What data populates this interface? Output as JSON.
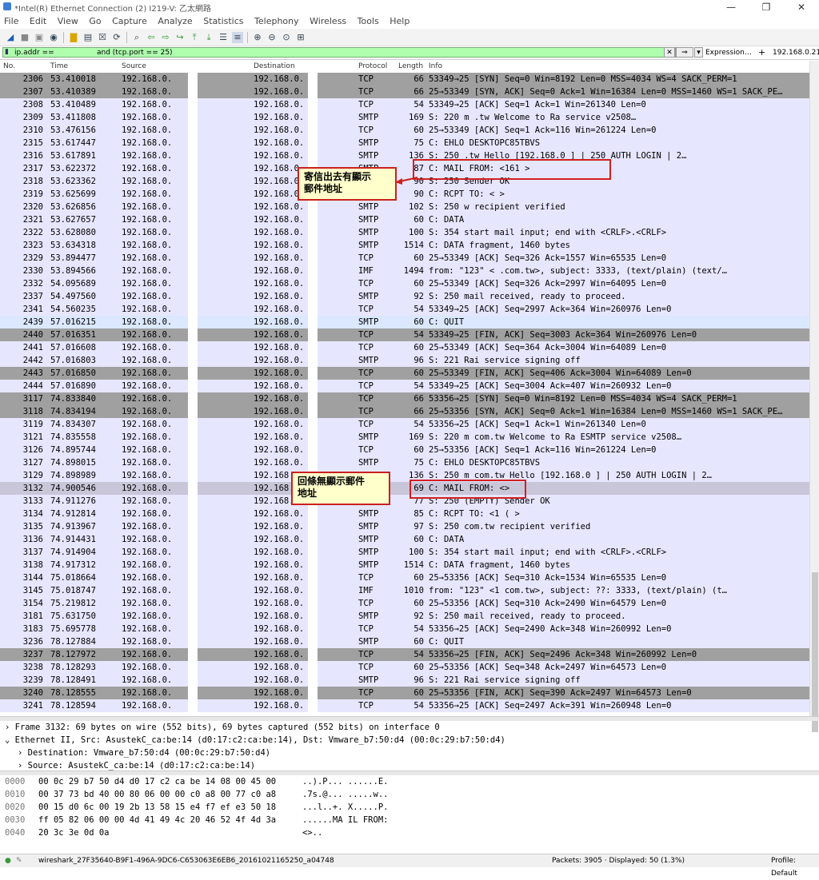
{
  "window": {
    "title": "*Intel(R) Ethernet Connection (2) I219-V: 乙太網路",
    "buttons": [
      "—",
      "❐",
      "✕"
    ]
  },
  "menu": [
    "File",
    "Edit",
    "View",
    "Go",
    "Capture",
    "Analyze",
    "Statistics",
    "Telephony",
    "Wireless",
    "Tools",
    "Help"
  ],
  "toolbar_icons": [
    "shark-fin-icon",
    "stop-icon",
    "restart-icon",
    "options-icon",
    "open-icon",
    "save-icon",
    "close-file-icon",
    "reload-icon",
    "find-icon",
    "back-icon",
    "forward-icon",
    "goto-icon",
    "first-icon",
    "last-icon",
    "autoscroll-icon",
    "colorize-icon",
    "zoom-in-icon",
    "zoom-out-icon",
    "zoom-reset-icon",
    "resize-columns-icon"
  ],
  "filter": {
    "text_part1": "ip.addr ==",
    "text_part2": "and (tcp.port == 25)",
    "expression_label": "Expression…",
    "plus_label": "+",
    "ip_button": "192.168.0.21",
    "bg_color": "#afffaf"
  },
  "columns": [
    "No.",
    "Time",
    "Source",
    "Destination",
    "Protocol",
    "Length",
    "Info"
  ],
  "packets": [
    {
      "no": "2306",
      "time": "53.410018",
      "src": "192.168.0.",
      "dst": "192.168.0.",
      "proto": "TCP",
      "len": "66",
      "info": "53349→25 [SYN] Seq=0 Win=8192 Len=0 MSS=4034 WS=4 SACK_PERM=1",
      "cls": "c-syn"
    },
    {
      "no": "2307",
      "time": "53.410389",
      "src": "192.168.0.",
      "dst": "192.168.0.",
      "proto": "TCP",
      "len": "66",
      "info": "25→53349 [SYN, ACK] Seq=0 Ack=1 Win=16384 Len=0 MSS=1460 WS=1 SACK_PE…",
      "cls": "c-syn"
    },
    {
      "no": "2308",
      "time": "53.410489",
      "src": "192.168.0.",
      "dst": "192.168.0.",
      "proto": "TCP",
      "len": "54",
      "info": "53349→25 [ACK] Seq=1 Ack=1 Win=261340 Len=0",
      "cls": "c-tcp"
    },
    {
      "no": "2309",
      "time": "53.411808",
      "src": "192.168.0.",
      "dst": "192.168.0.",
      "proto": "SMTP",
      "len": "169",
      "info": "S: 220          m      .tw Welcome to Ra                  service v2508…",
      "cls": "c-smtp"
    },
    {
      "no": "2310",
      "time": "53.476156",
      "src": "192.168.0.",
      "dst": "192.168.0.",
      "proto": "TCP",
      "len": "60",
      "info": "25→53349 [ACK] Seq=1 Ack=116 Win=261224 Len=0",
      "cls": "c-tcp"
    },
    {
      "no": "2315",
      "time": "53.617447",
      "src": "192.168.0.",
      "dst": "192.168.0.",
      "proto": "SMTP",
      "len": "75",
      "info": "C: EHLO DESKTOPC85TBVS",
      "cls": "c-smtp"
    },
    {
      "no": "2316",
      "time": "53.617891",
      "src": "192.168.0.",
      "dst": "192.168.0.",
      "proto": "SMTP",
      "len": "136",
      "info": "S: 250              .tw Hello [192.168.0     ] | 250 AUTH LOGIN | 2…",
      "cls": "c-smtp"
    },
    {
      "no": "2317",
      "time": "53.622372",
      "src": "192.168.0.",
      "dst": "192.168.0.",
      "proto": "SMTP",
      "len": "87",
      "info": "C: MAIL FROM: <161               >",
      "cls": "c-smtp"
    },
    {
      "no": "2318",
      "time": "53.623362",
      "src": "192.168.0.",
      "dst": "192.168.0.",
      "proto": "SMTP",
      "len": "90",
      "info": "S: 250                    Sender OK",
      "cls": "c-smtp"
    },
    {
      "no": "2319",
      "time": "53.625699",
      "src": "192.168.0.",
      "dst": "192.168.0.",
      "proto": "SMTP",
      "len": "90",
      "info": "C: RCPT TO: <                      >",
      "cls": "c-smtp"
    },
    {
      "no": "2320",
      "time": "53.626856",
      "src": "192.168.0.",
      "dst": "192.168.0.",
      "proto": "SMTP",
      "len": "102",
      "info": "S: 250                    w recipient verified",
      "cls": "c-smtp"
    },
    {
      "no": "2321",
      "time": "53.627657",
      "src": "192.168.0.",
      "dst": "192.168.0.",
      "proto": "SMTP",
      "len": "60",
      "info": "C: DATA",
      "cls": "c-smtp"
    },
    {
      "no": "2322",
      "time": "53.628080",
      "src": "192.168.0.",
      "dst": "192.168.0.",
      "proto": "SMTP",
      "len": "100",
      "info": "S: 354 start mail input; end with <CRLF>.<CRLF>",
      "cls": "c-smtp"
    },
    {
      "no": "2323",
      "time": "53.634318",
      "src": "192.168.0.",
      "dst": "192.168.0.",
      "proto": "SMTP",
      "len": "1514",
      "info": "C: DATA fragment, 1460 bytes",
      "cls": "c-smtp"
    },
    {
      "no": "2329",
      "time": "53.894477",
      "src": "192.168.0.",
      "dst": "192.168.0.",
      "proto": "TCP",
      "len": "60",
      "info": "25→53349 [ACK] Seq=326 Ack=1557 Win=65535 Len=0",
      "cls": "c-tcp"
    },
    {
      "no": "2330",
      "time": "53.894566",
      "src": "192.168.0.",
      "dst": "192.168.0.",
      "proto": "IMF",
      "len": "1494",
      "info": "from: \"123\" <           .com.tw>, subject: 3333,  (text/plain) (text/…",
      "cls": "c-imf"
    },
    {
      "no": "2332",
      "time": "54.095689",
      "src": "192.168.0.",
      "dst": "192.168.0.",
      "proto": "TCP",
      "len": "60",
      "info": "25→53349 [ACK] Seq=326 Ack=2997 Win=64095 Len=0",
      "cls": "c-tcp"
    },
    {
      "no": "2337",
      "time": "54.497560",
      "src": "192.168.0.",
      "dst": "192.168.0.",
      "proto": "SMTP",
      "len": "92",
      "info": "S: 250 mail received, ready to proceed.",
      "cls": "c-smtp"
    },
    {
      "no": "2341",
      "time": "54.560235",
      "src": "192.168.0.",
      "dst": "192.168.0.",
      "proto": "TCP",
      "len": "54",
      "info": "53349→25 [ACK] Seq=2997 Ack=364 Win=260976 Len=0",
      "cls": "c-tcp"
    },
    {
      "no": "2439",
      "time": "57.016215",
      "src": "192.168.0.",
      "dst": "192.168.0.",
      "proto": "SMTP",
      "len": "60",
      "info": "C: QUIT",
      "cls": "c-quit"
    },
    {
      "no": "2440",
      "time": "57.016351",
      "src": "192.168.0.",
      "dst": "192.168.0.",
      "proto": "TCP",
      "len": "54",
      "info": "53349→25 [FIN, ACK] Seq=3003 Ack=364 Win=260976 Len=0",
      "cls": "c-fin"
    },
    {
      "no": "2441",
      "time": "57.016608",
      "src": "192.168.0.",
      "dst": "192.168.0.",
      "proto": "TCP",
      "len": "60",
      "info": "25→53349 [ACK] Seq=364 Ack=3004 Win=64089 Len=0",
      "cls": "c-tcp"
    },
    {
      "no": "2442",
      "time": "57.016803",
      "src": "192.168.0.",
      "dst": "192.168.0.",
      "proto": "SMTP",
      "len": "96",
      "info": "S: 221 Rai                 service signing off",
      "cls": "c-smtp"
    },
    {
      "no": "2443",
      "time": "57.016850",
      "src": "192.168.0.",
      "dst": "192.168.0.",
      "proto": "TCP",
      "len": "60",
      "info": "25→53349 [FIN, ACK] Seq=406 Ack=3004 Win=64089 Len=0",
      "cls": "c-fin"
    },
    {
      "no": "2444",
      "time": "57.016890",
      "src": "192.168.0.",
      "dst": "192.168.0.",
      "proto": "TCP",
      "len": "54",
      "info": "53349→25 [ACK] Seq=3004 Ack=407 Win=260932 Len=0",
      "cls": "c-tcp"
    },
    {
      "no": "3117",
      "time": "74.833840",
      "src": "192.168.0.",
      "dst": "192.168.0.",
      "proto": "TCP",
      "len": "66",
      "info": "53356→25 [SYN] Seq=0 Win=8192 Len=0 MSS=4034 WS=4 SACK_PERM=1",
      "cls": "c-syn"
    },
    {
      "no": "3118",
      "time": "74.834194",
      "src": "192.168.0.",
      "dst": "192.168.0.",
      "proto": "TCP",
      "len": "66",
      "info": "25→53356 [SYN, ACK] Seq=0 Ack=1 Win=16384 Len=0 MSS=1460 WS=1 SACK_PE…",
      "cls": "c-syn"
    },
    {
      "no": "3119",
      "time": "74.834307",
      "src": "192.168.0.",
      "dst": "192.168.0.",
      "proto": "TCP",
      "len": "54",
      "info": "53356→25 [ACK] Seq=1 Ack=1 Win=261340 Len=0",
      "cls": "c-tcp"
    },
    {
      "no": "3121",
      "time": "74.835558",
      "src": "192.168.0.",
      "dst": "192.168.0.",
      "proto": "SMTP",
      "len": "169",
      "info": "S: 220 m           com.tw Welcome to Ra              ESMTP service v2508…",
      "cls": "c-smtp"
    },
    {
      "no": "3126",
      "time": "74.895744",
      "src": "192.168.0.",
      "dst": "192.168.0.",
      "proto": "TCP",
      "len": "60",
      "info": "25→53356 [ACK] Seq=1 Ack=116 Win=261224 Len=0",
      "cls": "c-tcp"
    },
    {
      "no": "3127",
      "time": "74.898015",
      "src": "192.168.0.",
      "dst": "192.168.0.",
      "proto": "SMTP",
      "len": "75",
      "info": "C: EHLO DESKTOPC85TBVS",
      "cls": "c-smtp"
    },
    {
      "no": "3129",
      "time": "74.898989",
      "src": "192.168.0.",
      "dst": "192.168",
      "proto": "SMTP",
      "len": "136",
      "info": "S: 250 m           com.tw Hello [192.168.0     ] | 250 AUTH LOGIN | 2…",
      "cls": "c-smtp"
    },
    {
      "no": "3132",
      "time": "74.900546",
      "src": "192.168.0.",
      "dst": "192.168",
      "proto": "SMTP",
      "len": "69",
      "info": "C: MAIL FROM: <>",
      "cls": "c-sel"
    },
    {
      "no": "3133",
      "time": "74.911276",
      "src": "192.168.0.",
      "dst": "192.168.0.",
      "proto": "SMTP",
      "len": "77",
      "info": "S: 250 (EMPTY) Sender OK",
      "cls": "c-smtp"
    },
    {
      "no": "3134",
      "time": "74.912814",
      "src": "192.168.0.",
      "dst": "192.168.0.",
      "proto": "SMTP",
      "len": "85",
      "info": "C: RCPT TO: <1   (                >",
      "cls": "c-smtp"
    },
    {
      "no": "3135",
      "time": "74.913967",
      "src": "192.168.0.",
      "dst": "192.168.0.",
      "proto": "SMTP",
      "len": "97",
      "info": "S: 250           com.tw recipient verified",
      "cls": "c-smtp"
    },
    {
      "no": "3136",
      "time": "74.914431",
      "src": "192.168.0.",
      "dst": "192.168.0.",
      "proto": "SMTP",
      "len": "60",
      "info": "C: DATA",
      "cls": "c-smtp"
    },
    {
      "no": "3137",
      "time": "74.914904",
      "src": "192.168.0.",
      "dst": "192.168.0.",
      "proto": "SMTP",
      "len": "100",
      "info": "S: 354 start mail input; end with <CRLF>.<CRLF>",
      "cls": "c-smtp"
    },
    {
      "no": "3138",
      "time": "74.917312",
      "src": "192.168.0.",
      "dst": "192.168.0.",
      "proto": "SMTP",
      "len": "1514",
      "info": "C: DATA fragment, 1460 bytes",
      "cls": "c-smtp"
    },
    {
      "no": "3144",
      "time": "75.018664",
      "src": "192.168.0.",
      "dst": "192.168.0.",
      "proto": "TCP",
      "len": "60",
      "info": "25→53356 [ACK] Seq=310 Ack=1534 Win=65535 Len=0",
      "cls": "c-tcp"
    },
    {
      "no": "3145",
      "time": "75.018747",
      "src": "192.168.0.",
      "dst": "192.168.0.",
      "proto": "IMF",
      "len": "1010",
      "info": "from: \"123\" <1          com.tw>, subject: ??: 3333,  (text/plain) (t…",
      "cls": "c-imf"
    },
    {
      "no": "3154",
      "time": "75.219812",
      "src": "192.168.0.",
      "dst": "192.168.0.",
      "proto": "TCP",
      "len": "60",
      "info": "25→53356 [ACK] Seq=310 Ack=2490 Win=64579 Len=0",
      "cls": "c-tcp"
    },
    {
      "no": "3181",
      "time": "75.631750",
      "src": "192.168.0.",
      "dst": "192.168.0.",
      "proto": "SMTP",
      "len": "92",
      "info": "S: 250 mail received, ready to proceed.",
      "cls": "c-smtp"
    },
    {
      "no": "3183",
      "time": "75.695778",
      "src": "192.168.0.",
      "dst": "192.168.0.",
      "proto": "TCP",
      "len": "54",
      "info": "53356→25 [ACK] Seq=2490 Ack=348 Win=260992 Len=0",
      "cls": "c-tcp"
    },
    {
      "no": "3236",
      "time": "78.127884",
      "src": "192.168.0.",
      "dst": "192.168.0.",
      "proto": "SMTP",
      "len": "60",
      "info": "C: QUIT",
      "cls": "c-smtp"
    },
    {
      "no": "3237",
      "time": "78.127972",
      "src": "192.168.0.",
      "dst": "192.168.0.",
      "proto": "TCP",
      "len": "54",
      "info": "53356→25 [FIN, ACK] Seq=2496 Ack=348 Win=260992 Len=0",
      "cls": "c-fin"
    },
    {
      "no": "3238",
      "time": "78.128293",
      "src": "192.168.0.",
      "dst": "192.168.0.",
      "proto": "TCP",
      "len": "60",
      "info": "25→53356 [ACK] Seq=348 Ack=2497 Win=64573 Len=0",
      "cls": "c-tcp"
    },
    {
      "no": "3239",
      "time": "78.128491",
      "src": "192.168.0.",
      "dst": "192.168.0.",
      "proto": "SMTP",
      "len": "96",
      "info": "S: 221 Rai                 service signing off",
      "cls": "c-smtp"
    },
    {
      "no": "3240",
      "time": "78.128555",
      "src": "192.168.0.",
      "dst": "192.168.0.",
      "proto": "TCP",
      "len": "60",
      "info": "25→53356 [FIN, ACK] Seq=390 Ack=2497 Win=64573 Len=0",
      "cls": "c-fin"
    },
    {
      "no": "3241",
      "time": "78.128594",
      "src": "192.168.0.",
      "dst": "192.168.0.",
      "proto": "TCP",
      "len": "54",
      "info": "53356→25 [ACK] Seq=2497 Ack=391 Win=260948 Len=0",
      "cls": "c-tcp"
    }
  ],
  "callouts": {
    "top": "寄信出去有顯示\n郵件地址",
    "bottom": "回條無顯示郵件\n地址"
  },
  "details": [
    {
      "marker": "›",
      "text": "Frame 3132: 69 bytes on wire (552 bits), 69 bytes captured (552 bits) on interface 0"
    },
    {
      "marker": "⌄",
      "text": "Ethernet II, Src: AsustekC_ca:be:14 (d0:17:c2:ca:be:14), Dst: Vmware_b7:50:d4 (00:0c:29:b7:50:d4)"
    },
    {
      "marker": "›",
      "text": "Destination: Vmware_b7:50:d4 (00:0c:29:b7:50:d4)"
    },
    {
      "marker": "›",
      "text": "Source: AsustekC_ca:be:14 (d0:17:c2:ca:be:14)"
    }
  ],
  "bytes": [
    {
      "off": "0000",
      "hex": "00 0c 29 b7 50 d4 d0 17  c2 ca be 14 08 00 45 00",
      "ascii": "..).P... ......E."
    },
    {
      "off": "0010",
      "hex": "00 37 73 bd 40 00 80 06  00 00 c0 a8 00 77 c0 a8",
      "ascii": ".7s.@... .....w.."
    },
    {
      "off": "0020",
      "hex": "00 15 d0 6c 00 19 2b 13  58 15 e4 f7 ef e3 50 18",
      "ascii": "...l..+. X.....P."
    },
    {
      "off": "0030",
      "hex": "ff 05 82 06 00 00 4d 41  49 4c 20 46 52 4f 4d 3a",
      "ascii": "......MA IL FROM:"
    },
    {
      "off": "0040",
      "hex": "20 3c 3e 0d 0a",
      "ascii": "<>.."
    }
  ],
  "status": {
    "file": "wireshark_27F35640-B9F1-496A-9DC6-C653063E6EB6_20161021165250_a04748",
    "packets": "Packets: 3905 · Displayed: 50 (1.3%)",
    "profile": "Profile: Default"
  }
}
